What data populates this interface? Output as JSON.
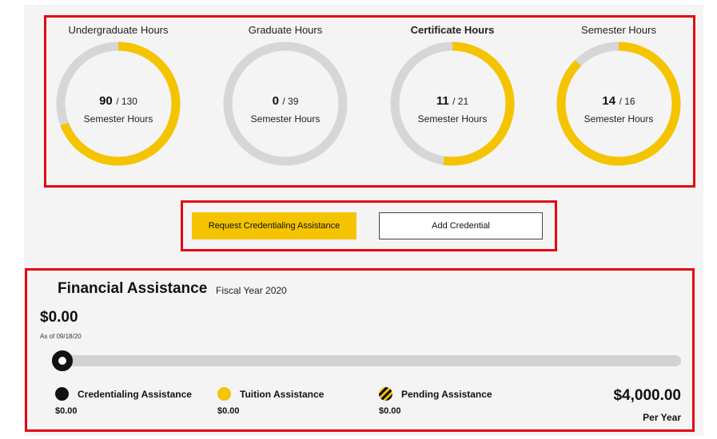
{
  "gauges": [
    {
      "title": "Undergraduate Hours",
      "title_bold": false,
      "value": "90",
      "total": "/ 130",
      "completed": 90,
      "max": 130,
      "unit": "Semester Hours"
    },
    {
      "title": "Graduate Hours",
      "title_bold": false,
      "value": "0",
      "total": "/ 39",
      "completed": 0,
      "max": 39,
      "unit": "Semester Hours"
    },
    {
      "title": "Certificate Hours",
      "title_bold": true,
      "value": "11",
      "total": "/ 21",
      "completed": 11,
      "max": 21,
      "unit": "Semester Hours"
    },
    {
      "title": "Semester Hours",
      "title_bold": false,
      "value": "14",
      "total": "/ 16",
      "completed": 14,
      "max": 16,
      "unit": "Semester Hours"
    }
  ],
  "buttons": {
    "request_label": "Request Credentialing Assistance",
    "add_label": "Add Credential"
  },
  "financial": {
    "title": "Financial Assistance",
    "fiscal_year": "Fiscal Year 2020",
    "amount": "$0.00",
    "as_of": "As of 09/18/20",
    "progress_fraction": 0,
    "max_amount": "$4,000.00",
    "max_unit": "Per Year",
    "legend": [
      {
        "label": "Credentialing Assistance",
        "value": "$0.00",
        "color": "#111111",
        "pattern": "solid"
      },
      {
        "label": "Tuition Assistance",
        "value": "$0.00",
        "color": "#f5c400",
        "pattern": "solid"
      },
      {
        "label": "Pending Assistance",
        "value": "$0.00",
        "color": "#f5c400",
        "pattern": "striped"
      }
    ]
  },
  "colors": {
    "accent": "#f5c400",
    "track": "#d6d6d6",
    "highlight_border": "#e30613"
  }
}
